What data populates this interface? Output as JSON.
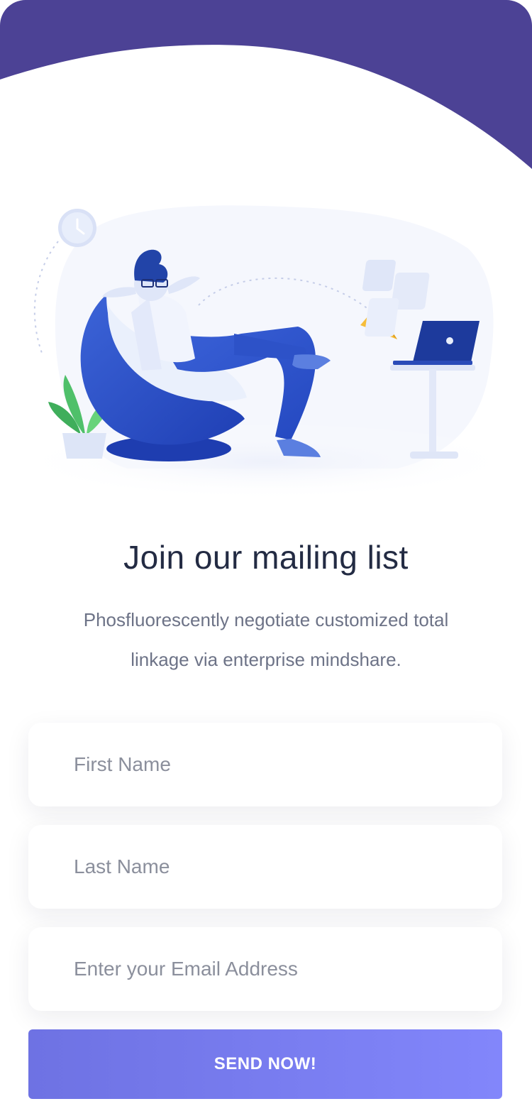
{
  "header": {
    "title": "Join our mailing list",
    "subtitle_line1": "Phosfluorescently negotiate customized total",
    "subtitle_line2": "linkage via enterprise mindshare."
  },
  "form": {
    "first_name": {
      "value": "",
      "placeholder": "First Name"
    },
    "last_name": {
      "value": "",
      "placeholder": "Last Name"
    },
    "email": {
      "value": "",
      "placeholder": "Enter your Email Address"
    },
    "submit_label": "SEND NOW!"
  },
  "colors": {
    "header_wave": "#4c4295",
    "accent": "#7377ea",
    "title_text": "#232b43",
    "body_text": "#6d7387"
  },
  "illustration": {
    "icons": [
      "clock-icon",
      "paper-plane-icon",
      "laptop-icon",
      "plant-icon"
    ]
  }
}
